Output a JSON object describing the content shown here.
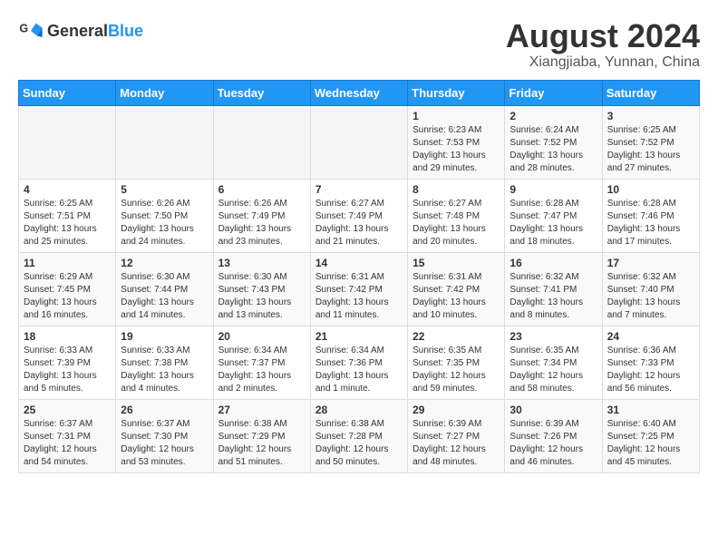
{
  "logo": {
    "general": "General",
    "blue": "Blue"
  },
  "title": "August 2024",
  "subtitle": "Xiangjiaba, Yunnan, China",
  "days_of_week": [
    "Sunday",
    "Monday",
    "Tuesday",
    "Wednesday",
    "Thursday",
    "Friday",
    "Saturday"
  ],
  "weeks": [
    [
      {
        "day": "",
        "info": ""
      },
      {
        "day": "",
        "info": ""
      },
      {
        "day": "",
        "info": ""
      },
      {
        "day": "",
        "info": ""
      },
      {
        "day": "1",
        "info": "Sunrise: 6:23 AM\nSunset: 7:53 PM\nDaylight: 13 hours and 29 minutes."
      },
      {
        "day": "2",
        "info": "Sunrise: 6:24 AM\nSunset: 7:52 PM\nDaylight: 13 hours and 28 minutes."
      },
      {
        "day": "3",
        "info": "Sunrise: 6:25 AM\nSunset: 7:52 PM\nDaylight: 13 hours and 27 minutes."
      }
    ],
    [
      {
        "day": "4",
        "info": "Sunrise: 6:25 AM\nSunset: 7:51 PM\nDaylight: 13 hours and 25 minutes."
      },
      {
        "day": "5",
        "info": "Sunrise: 6:26 AM\nSunset: 7:50 PM\nDaylight: 13 hours and 24 minutes."
      },
      {
        "day": "6",
        "info": "Sunrise: 6:26 AM\nSunset: 7:49 PM\nDaylight: 13 hours and 23 minutes."
      },
      {
        "day": "7",
        "info": "Sunrise: 6:27 AM\nSunset: 7:49 PM\nDaylight: 13 hours and 21 minutes."
      },
      {
        "day": "8",
        "info": "Sunrise: 6:27 AM\nSunset: 7:48 PM\nDaylight: 13 hours and 20 minutes."
      },
      {
        "day": "9",
        "info": "Sunrise: 6:28 AM\nSunset: 7:47 PM\nDaylight: 13 hours and 18 minutes."
      },
      {
        "day": "10",
        "info": "Sunrise: 6:28 AM\nSunset: 7:46 PM\nDaylight: 13 hours and 17 minutes."
      }
    ],
    [
      {
        "day": "11",
        "info": "Sunrise: 6:29 AM\nSunset: 7:45 PM\nDaylight: 13 hours and 16 minutes."
      },
      {
        "day": "12",
        "info": "Sunrise: 6:30 AM\nSunset: 7:44 PM\nDaylight: 13 hours and 14 minutes."
      },
      {
        "day": "13",
        "info": "Sunrise: 6:30 AM\nSunset: 7:43 PM\nDaylight: 13 hours and 13 minutes."
      },
      {
        "day": "14",
        "info": "Sunrise: 6:31 AM\nSunset: 7:42 PM\nDaylight: 13 hours and 11 minutes."
      },
      {
        "day": "15",
        "info": "Sunrise: 6:31 AM\nSunset: 7:42 PM\nDaylight: 13 hours and 10 minutes."
      },
      {
        "day": "16",
        "info": "Sunrise: 6:32 AM\nSunset: 7:41 PM\nDaylight: 13 hours and 8 minutes."
      },
      {
        "day": "17",
        "info": "Sunrise: 6:32 AM\nSunset: 7:40 PM\nDaylight: 13 hours and 7 minutes."
      }
    ],
    [
      {
        "day": "18",
        "info": "Sunrise: 6:33 AM\nSunset: 7:39 PM\nDaylight: 13 hours and 5 minutes."
      },
      {
        "day": "19",
        "info": "Sunrise: 6:33 AM\nSunset: 7:38 PM\nDaylight: 13 hours and 4 minutes."
      },
      {
        "day": "20",
        "info": "Sunrise: 6:34 AM\nSunset: 7:37 PM\nDaylight: 13 hours and 2 minutes."
      },
      {
        "day": "21",
        "info": "Sunrise: 6:34 AM\nSunset: 7:36 PM\nDaylight: 13 hours and 1 minute."
      },
      {
        "day": "22",
        "info": "Sunrise: 6:35 AM\nSunset: 7:35 PM\nDaylight: 12 hours and 59 minutes."
      },
      {
        "day": "23",
        "info": "Sunrise: 6:35 AM\nSunset: 7:34 PM\nDaylight: 12 hours and 58 minutes."
      },
      {
        "day": "24",
        "info": "Sunrise: 6:36 AM\nSunset: 7:33 PM\nDaylight: 12 hours and 56 minutes."
      }
    ],
    [
      {
        "day": "25",
        "info": "Sunrise: 6:37 AM\nSunset: 7:31 PM\nDaylight: 12 hours and 54 minutes."
      },
      {
        "day": "26",
        "info": "Sunrise: 6:37 AM\nSunset: 7:30 PM\nDaylight: 12 hours and 53 minutes."
      },
      {
        "day": "27",
        "info": "Sunrise: 6:38 AM\nSunset: 7:29 PM\nDaylight: 12 hours and 51 minutes."
      },
      {
        "day": "28",
        "info": "Sunrise: 6:38 AM\nSunset: 7:28 PM\nDaylight: 12 hours and 50 minutes."
      },
      {
        "day": "29",
        "info": "Sunrise: 6:39 AM\nSunset: 7:27 PM\nDaylight: 12 hours and 48 minutes."
      },
      {
        "day": "30",
        "info": "Sunrise: 6:39 AM\nSunset: 7:26 PM\nDaylight: 12 hours and 46 minutes."
      },
      {
        "day": "31",
        "info": "Sunrise: 6:40 AM\nSunset: 7:25 PM\nDaylight: 12 hours and 45 minutes."
      }
    ]
  ]
}
